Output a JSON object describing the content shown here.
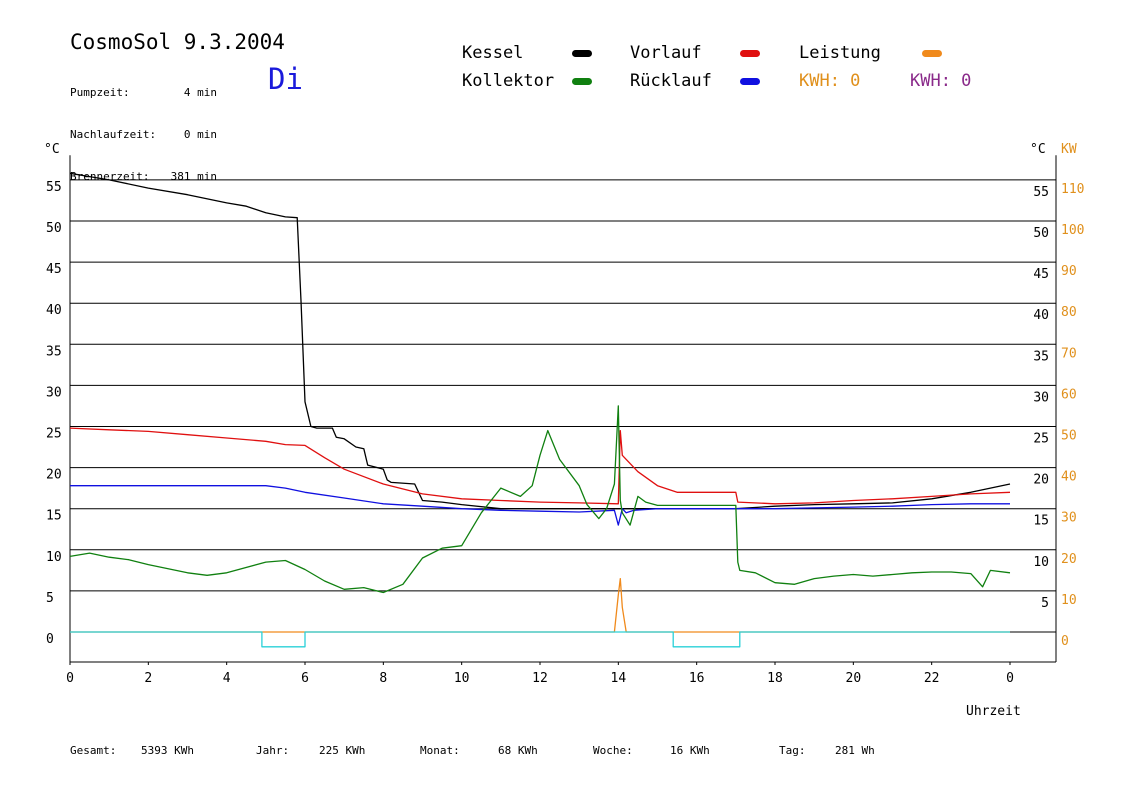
{
  "header": {
    "title": "CosmoSol 9.3.2004",
    "day": "Di",
    "info": [
      {
        "label": "Pumpzeit:",
        "value": "4 min"
      },
      {
        "label": "Nachlaufzeit:",
        "value": "0 min"
      },
      {
        "label": "Brennerzeit:",
        "value": "381 min"
      }
    ]
  },
  "legend": {
    "kessel": {
      "label": "Kessel",
      "color": "#000000"
    },
    "vorlauf": {
      "label": "Vorlauf",
      "color": "#e01010"
    },
    "leistung": {
      "label": "Leistung",
      "color": "#f08a1c"
    },
    "kollektor": {
      "label": "Kollektor",
      "color": "#108010"
    },
    "ruecklauf": {
      "label": "Rücklauf",
      "color": "#1010e0"
    },
    "kwh1": {
      "label": "KWH: 0",
      "color": "#e0901c"
    },
    "kwh2": {
      "label": "KWH: 0",
      "color": "#8a2a8a"
    }
  },
  "footer": [
    {
      "label": "Gesamt:",
      "value": "5393 KWh"
    },
    {
      "label": "Jahr:",
      "value": "225 KWh"
    },
    {
      "label": "Monat:",
      "value": "68 KWh"
    },
    {
      "label": "Woche:",
      "value": "16 KWh"
    },
    {
      "label": "Tag:",
      "value": "281 Wh"
    }
  ],
  "chart_data": {
    "type": "line",
    "title": "CosmoSol 9.3.2004",
    "xlabel": "Uhrzeit",
    "ylabel_left": "°C",
    "ylabel_right": "KW",
    "xlim": [
      0,
      24
    ],
    "ylim": [
      -7.5,
      58
    ],
    "ylim_right": [
      0,
      110
    ],
    "x_ticks": [
      0,
      2,
      4,
      6,
      8,
      10,
      12,
      14,
      16,
      18,
      20,
      22,
      24
    ],
    "x_tick_labels": [
      "0",
      "2",
      "4",
      "6",
      "8",
      "10",
      "12",
      "14",
      "16",
      "18",
      "20",
      "22",
      "0"
    ],
    "y_ticks": [
      0,
      5,
      10,
      15,
      20,
      25,
      30,
      35,
      40,
      45,
      50,
      55
    ],
    "y_ticks_right": [
      0,
      10,
      20,
      30,
      40,
      50,
      60,
      70,
      80,
      90,
      100,
      110
    ],
    "grid": true,
    "series": [
      {
        "name": "Kessel",
        "color": "#000000",
        "x": [
          0,
          0.5,
          1,
          2,
          3,
          4,
          4.5,
          5,
          5.5,
          5.8,
          5.9,
          6.0,
          6.15,
          6.3,
          6.7,
          6.8,
          7.0,
          7.3,
          7.5,
          7.6,
          8.0,
          8.1,
          8.2,
          8.8,
          8.9,
          9.0,
          9.5,
          10,
          11,
          12,
          13,
          14,
          15,
          16,
          17,
          18,
          19,
          20,
          21,
          22,
          23,
          24
        ],
        "y": [
          55.8,
          55.4,
          55,
          54,
          53.2,
          52.2,
          51.8,
          51,
          50.5,
          50.4,
          40,
          28,
          25,
          24.8,
          24.8,
          23.7,
          23.5,
          22.5,
          22.3,
          20.3,
          19.8,
          18.5,
          18.2,
          18.0,
          17.0,
          16.0,
          15.8,
          15.5,
          15.0,
          15.0,
          15.0,
          15.0,
          15.0,
          15.0,
          15.0,
          15.3,
          15.5,
          15.6,
          15.7,
          16.2,
          17.0,
          18.0
        ]
      },
      {
        "name": "Vorlauf",
        "color": "#e01010",
        "x": [
          0,
          1,
          2,
          3,
          4,
          5,
          5.5,
          6,
          6.5,
          7,
          8,
          9,
          10,
          11,
          12,
          13,
          14,
          14.05,
          14.1,
          14.2,
          14.5,
          15,
          15.5,
          17,
          17.05,
          18,
          19,
          20,
          21,
          22,
          23,
          24
        ],
        "y": [
          24.8,
          24.6,
          24.4,
          24.0,
          23.6,
          23.2,
          22.8,
          22.7,
          21.2,
          19.8,
          18.0,
          16.8,
          16.2,
          16.0,
          15.8,
          15.7,
          15.6,
          24.5,
          21.5,
          21.0,
          19.5,
          17.8,
          17.0,
          17.0,
          15.8,
          15.6,
          15.7,
          16.0,
          16.2,
          16.5,
          16.8,
          17.0
        ]
      },
      {
        "name": "Rücklauf",
        "color": "#1010e0",
        "x": [
          0,
          1,
          2,
          3,
          4,
          5,
          5.5,
          6,
          7,
          8,
          9,
          10,
          11,
          12,
          13,
          13.9,
          14.0,
          14.1,
          14.2,
          14.4,
          15,
          16,
          17,
          18,
          19,
          20,
          21,
          22,
          23,
          24
        ],
        "y": [
          17.8,
          17.8,
          17.8,
          17.8,
          17.8,
          17.8,
          17.5,
          17.0,
          16.3,
          15.6,
          15.3,
          15.0,
          14.8,
          14.7,
          14.6,
          14.8,
          13.0,
          15.0,
          14.5,
          14.8,
          15.0,
          15.0,
          15.0,
          15.0,
          15.1,
          15.2,
          15.3,
          15.5,
          15.6,
          15.6
        ]
      },
      {
        "name": "Kollektor",
        "color": "#108010",
        "x": [
          0,
          0.5,
          1,
          1.5,
          2,
          3,
          3.5,
          4,
          5,
          5.5,
          6,
          6.5,
          7,
          7.5,
          8,
          8.5,
          9,
          9.5,
          10,
          10.5,
          11,
          11.5,
          11.8,
          12,
          12.2,
          12.5,
          13,
          13.2,
          13.5,
          13.7,
          13.9,
          14.0,
          14.05,
          14.1,
          14.3,
          14.5,
          14.7,
          15,
          15.5,
          16,
          17,
          17.05,
          17.1,
          17.5,
          18,
          18.5,
          19,
          19.5,
          20,
          20.5,
          21,
          21.5,
          22,
          22.5,
          23,
          23.3,
          23.5,
          24
        ],
        "y": [
          9.2,
          9.6,
          9.1,
          8.8,
          8.2,
          7.2,
          6.9,
          7.2,
          8.5,
          8.7,
          7.6,
          6.2,
          5.2,
          5.4,
          4.8,
          5.8,
          9.0,
          10.2,
          10.5,
          14.5,
          17.5,
          16.5,
          17.8,
          21.5,
          24.5,
          21.0,
          17.8,
          15.5,
          13.8,
          15.0,
          18.0,
          27.5,
          16.0,
          14.5,
          13.0,
          16.5,
          15.8,
          15.4,
          15.4,
          15.4,
          15.4,
          8.5,
          7.5,
          7.2,
          6.0,
          5.8,
          6.5,
          6.8,
          7.0,
          6.8,
          7.0,
          7.2,
          7.3,
          7.3,
          7.1,
          5.5,
          7.5,
          7.2
        ]
      },
      {
        "name": "Leistung",
        "color": "#f08a1c",
        "x": [
          0,
          13.9,
          14.0,
          14.05,
          14.1,
          14.2,
          24
        ],
        "y": [
          0,
          0,
          4.5,
          6.5,
          3.0,
          0,
          0
        ]
      },
      {
        "name": "Pumpe",
        "color": "#2ad0d8",
        "x": [
          0,
          4.9,
          4.9,
          6.0,
          6.0,
          15.4,
          15.4,
          17.1,
          17.1,
          24
        ],
        "y": [
          0,
          0,
          -1.8,
          -1.8,
          0,
          0,
          -1.8,
          -1.8,
          0,
          0
        ]
      }
    ]
  }
}
